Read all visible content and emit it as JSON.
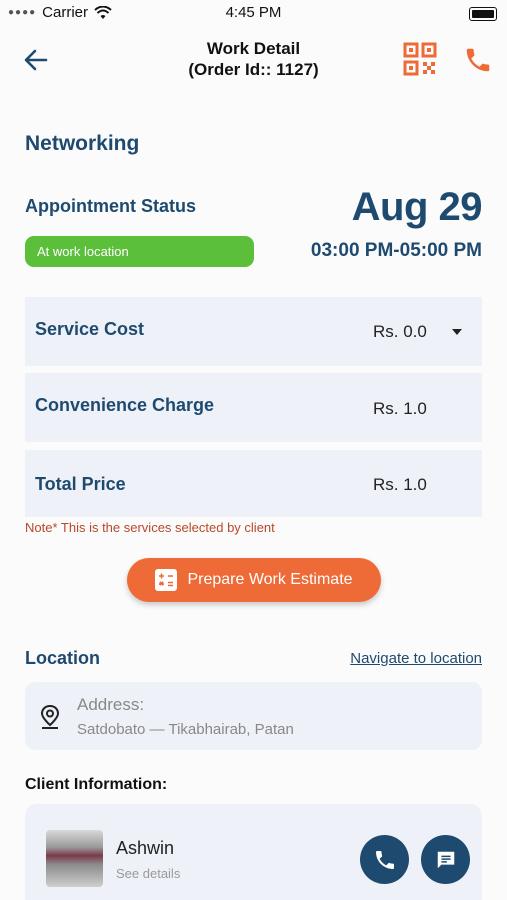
{
  "status_bar": {
    "carrier": "Carrier",
    "time": "4:45 PM"
  },
  "header": {
    "title_line1": "Work Detail",
    "title_line2": "(Order Id:: 1127)"
  },
  "service": {
    "name": "Networking"
  },
  "appointment": {
    "label": "Appointment Status",
    "status": "At work location",
    "date": "Aug 29",
    "time_range": "03:00 PM-05:00 PM"
  },
  "pricing": {
    "service_cost_label": "Service Cost",
    "service_cost_value": "Rs. 0.0",
    "convenience_label": "Convenience Charge",
    "convenience_value": "Rs. 1.0",
    "total_label": "Total Price",
    "total_value": "Rs. 1.0"
  },
  "note": "Note* This is the services selected by client",
  "estimate_button": "Prepare Work Estimate",
  "location": {
    "title": "Location",
    "navigate_link": "Navigate to location",
    "address_label": "Address:",
    "address_value": "Satdobato — Tikabhairab, Patan"
  },
  "client": {
    "title": "Client Information:",
    "name": "Ashwin",
    "details_link": "See details"
  },
  "colors": {
    "primary": "#1f4a70",
    "accent": "#ee6a36",
    "status_green": "#5bbf3a"
  },
  "icons": [
    "back-arrow-icon",
    "qr-code-icon",
    "phone-icon",
    "dropdown-caret-icon",
    "calculator-icon",
    "location-pin-icon",
    "chat-icon"
  ]
}
